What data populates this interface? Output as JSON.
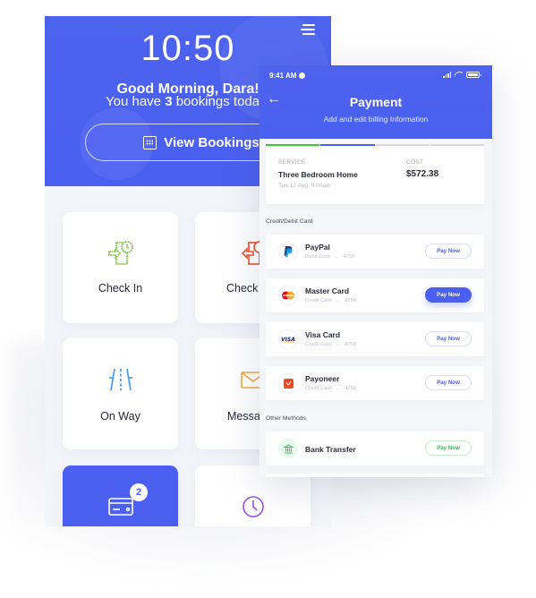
{
  "back_screen": {
    "clock": "10:50",
    "greeting": "Good Morning, Dara!",
    "bookings_prefix": "You have ",
    "bookings_count": "3",
    "bookings_suffix": " bookings today",
    "view_bookings_label": "View Bookings",
    "tiles": [
      {
        "label": "Check In",
        "icon": "check-in-icon",
        "color": "#7dc242"
      },
      {
        "label": "Check Out",
        "icon": "check-out-icon",
        "color": "#f0522b"
      },
      {
        "label": "On Way",
        "icon": "road-icon",
        "color": "#3a9bf0"
      },
      {
        "label": "Messages",
        "icon": "envelope-icon",
        "color": "#f5a93a"
      },
      {
        "label": "",
        "icon": "credit-card-icon",
        "badge": "2",
        "active": true
      },
      {
        "label": "",
        "icon": "clock-icon",
        "color": "#9a52e8"
      }
    ]
  },
  "front_screen": {
    "status_time": "9:41 AM",
    "title": "Payment",
    "subtitle": "Add and edit billing Information",
    "progress": {
      "completed_steps": 2,
      "total_steps": 4,
      "colors": [
        "#3bc93b",
        "#4b5ff0"
      ]
    },
    "service": {
      "service_label": "SERVICE",
      "service_name": "Three Bedroom Home",
      "service_date": "Tue,12 Aug, 9:00am",
      "cost_label": "COST",
      "cost_value": "$572.38"
    },
    "card_section_label": "Credit/Debit Card",
    "cards": [
      {
        "name": "PayPal",
        "type": "Debit Card",
        "mask": "...",
        "last4": "4758",
        "button": "Pay Now",
        "style": "outline"
      },
      {
        "name": "Master Card",
        "type": "Credit Card",
        "mask": "...",
        "last4": "4758",
        "button": "Pay Now",
        "style": "primary"
      },
      {
        "name": "Visa Card",
        "type": "Credit Card",
        "mask": "...",
        "last4": "4758",
        "button": "Pay Now",
        "style": "outline"
      },
      {
        "name": "Payoneer",
        "type": "Credit Card",
        "mask": "...",
        "last4": "4758",
        "button": "Pay Now",
        "style": "outline"
      }
    ],
    "other_section_label": "Other Methods",
    "other_methods": [
      {
        "name": "Bank Transfer",
        "button": "Pay Now",
        "style": "green"
      }
    ],
    "colors": {
      "accent": "#4b5ff0",
      "success": "#3bc25c"
    }
  }
}
